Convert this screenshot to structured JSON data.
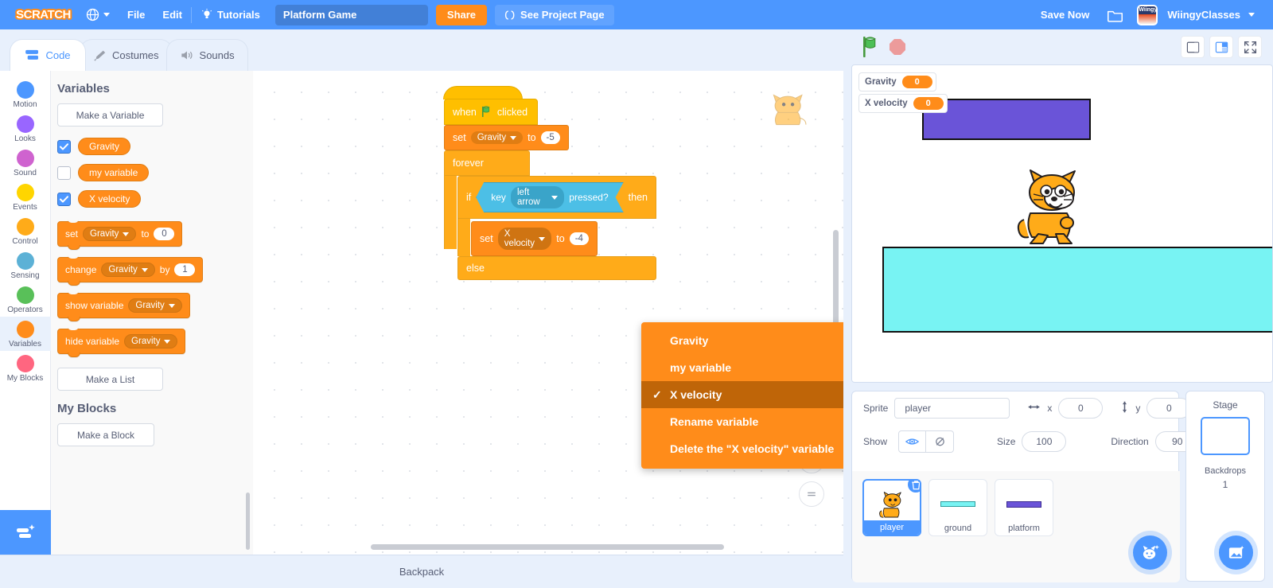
{
  "menubar": {
    "logo": "SCRATCH",
    "language_icon": "globe-icon",
    "file": "File",
    "edit": "Edit",
    "tutorials": "Tutorials",
    "tutorials_icon": "lightbulb-icon",
    "project_title": "Platform Game",
    "project_title_placeholder": "Project title",
    "share": "Share",
    "see_project_page": "See Project Page",
    "see_project_icon": "folder-share-icon",
    "save_now": "Save Now",
    "folder_icon": "folder-icon",
    "username": "WiingyClasses",
    "accent": "#4c97ff",
    "share_color": "#ff8c1a"
  },
  "tabs": [
    {
      "label": "Code",
      "icon": "code-blocks-icon",
      "active": true
    },
    {
      "label": "Costumes",
      "icon": "paintbrush-icon",
      "active": false
    },
    {
      "label": "Sounds",
      "icon": "speaker-icon",
      "active": false
    }
  ],
  "categories": [
    {
      "label": "Motion",
      "color": "#4c97ff",
      "selected": false
    },
    {
      "label": "Looks",
      "color": "#9966ff",
      "selected": false
    },
    {
      "label": "Sound",
      "color": "#cf63cf",
      "selected": false
    },
    {
      "label": "Events",
      "color": "#ffd500",
      "selected": false
    },
    {
      "label": "Control",
      "color": "#ffab19",
      "selected": false
    },
    {
      "label": "Sensing",
      "color": "#5cb1d6",
      "selected": false
    },
    {
      "label": "Operators",
      "color": "#59c059",
      "selected": false
    },
    {
      "label": "Variables",
      "color": "#ff8c1a",
      "selected": true
    },
    {
      "label": "My Blocks",
      "color": "#ff6680",
      "selected": false
    }
  ],
  "extension_button": {
    "name": "add-extension",
    "icon": "add-extension-icon"
  },
  "palette": {
    "heading": "Variables",
    "make_a_variable": "Make a Variable",
    "variables": [
      {
        "name": "Gravity",
        "checked": true
      },
      {
        "name": "my variable",
        "checked": false
      },
      {
        "name": "X velocity",
        "checked": true
      }
    ],
    "blocks": [
      {
        "id": "set",
        "pre": "set",
        "dropdown": "Gravity",
        "mid": "to",
        "value": "0"
      },
      {
        "id": "change",
        "pre": "change",
        "dropdown": "Gravity",
        "mid": "by",
        "value": "1"
      },
      {
        "id": "show",
        "pre": "show variable",
        "dropdown": "Gravity"
      },
      {
        "id": "hide",
        "pre": "hide variable",
        "dropdown": "Gravity"
      }
    ],
    "make_a_list": "Make a List",
    "my_blocks_heading": "My Blocks",
    "make_a_block": "Make a Block"
  },
  "script": {
    "hat": {
      "pre": "when",
      "icon": "green-flag-icon",
      "post": "clicked"
    },
    "set_gravity": {
      "pre": "set",
      "dropdown": "Gravity",
      "mid": "to",
      "value": "-5"
    },
    "forever": "forever",
    "if_block": {
      "pre": "if",
      "then": "then"
    },
    "key_pressed": {
      "pre": "key",
      "dropdown": "left arrow",
      "post": "pressed?"
    },
    "set_xvel": {
      "pre": "set",
      "dropdown": "X velocity",
      "mid": "to",
      "value": "-4"
    },
    "else": "else"
  },
  "dropdown_menu": {
    "items": [
      {
        "label": "Gravity",
        "selected": false
      },
      {
        "label": "my variable",
        "selected": false
      },
      {
        "label": "X velocity",
        "selected": true
      },
      {
        "label": "Rename variable",
        "selected": false
      },
      {
        "label": "Delete the \"X velocity\" variable",
        "selected": false
      }
    ]
  },
  "canvas_controls": {
    "zoom_in": "zoom-in-icon",
    "zoom_out": "zoom-out-icon",
    "zoom_reset": "zoom-reset-icon"
  },
  "backpack": {
    "label": "Backpack"
  },
  "stage_toolbar": {
    "green_flag": "green-flag-icon",
    "stop": "stop-icon",
    "small_stage": "small-stage-layout-icon",
    "large_stage": "large-stage-layout-icon",
    "fullscreen": "fullscreen-icon"
  },
  "stage": {
    "monitors": [
      {
        "label": "Gravity",
        "value": "0"
      },
      {
        "label": "X velocity",
        "value": "0"
      }
    ],
    "sprites_on_stage": [
      "platform",
      "ground",
      "player"
    ]
  },
  "sprite_info": {
    "sprite_label": "Sprite",
    "sprite_name": "player",
    "x_label": "x",
    "x_value": "0",
    "y_label": "y",
    "y_value": "0",
    "show_label": "Show",
    "show_visible_icon": "eye-icon",
    "show_hidden_icon": "eye-slash-icon",
    "size_label": "Size",
    "size_value": "100",
    "direction_label": "Direction",
    "direction_value": "90"
  },
  "sprite_list": [
    {
      "name": "player",
      "selected": true,
      "thumb": "cat-thumb"
    },
    {
      "name": "ground",
      "selected": false,
      "thumb": "cyan-bar-thumb"
    },
    {
      "name": "platform",
      "selected": false,
      "thumb": "purple-bar-thumb"
    }
  ],
  "add_sprite_button": {
    "name": "choose-a-sprite",
    "icon": "cat-face-icon"
  },
  "stage_selector": {
    "title": "Stage",
    "backdrops_label": "Backdrops",
    "backdrops_count": "1",
    "add_backdrop_icon": "image-icon"
  }
}
